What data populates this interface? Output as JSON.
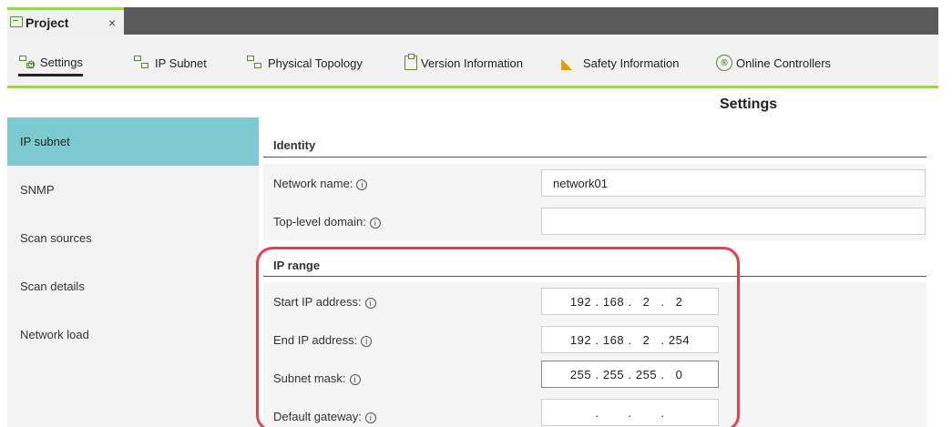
{
  "tab": {
    "title": "Project",
    "close": "×"
  },
  "toolbar": {
    "items": [
      {
        "label": "Settings"
      },
      {
        "label": "IP Subnet"
      },
      {
        "label": "Physical Topology"
      },
      {
        "label": "Version Information"
      },
      {
        "label": "Safety Information"
      },
      {
        "label": "Online Controllers"
      }
    ],
    "accent": "#9bd157"
  },
  "page": {
    "title": "Settings"
  },
  "sidebar": {
    "items": [
      {
        "label": "IP subnet"
      },
      {
        "label": "SNMP"
      },
      {
        "label": "Scan sources"
      },
      {
        "label": "Scan details"
      },
      {
        "label": "Network load"
      }
    ],
    "active_color": "#7ecad1"
  },
  "identity": {
    "heading": "Identity",
    "network_name": {
      "label": "Network name:",
      "value": "network01"
    },
    "top_level_domain": {
      "label": "Top-level domain:",
      "value": ""
    }
  },
  "ip_range": {
    "heading": "IP range",
    "start_ip": {
      "label": "Start IP address:",
      "octets": [
        "192",
        "168",
        "2",
        "2"
      ]
    },
    "end_ip": {
      "label": "End IP address:",
      "octets": [
        "192",
        "168",
        "2",
        "254"
      ]
    },
    "subnet_mask": {
      "label": "Subnet mask:",
      "octets": [
        "255",
        "255",
        "255",
        "0"
      ]
    },
    "default_gateway": {
      "label": "Default gateway:",
      "octets": [
        "",
        "",
        "",
        ""
      ]
    }
  },
  "info_glyph": "i",
  "highlight_color": "#e8404a"
}
